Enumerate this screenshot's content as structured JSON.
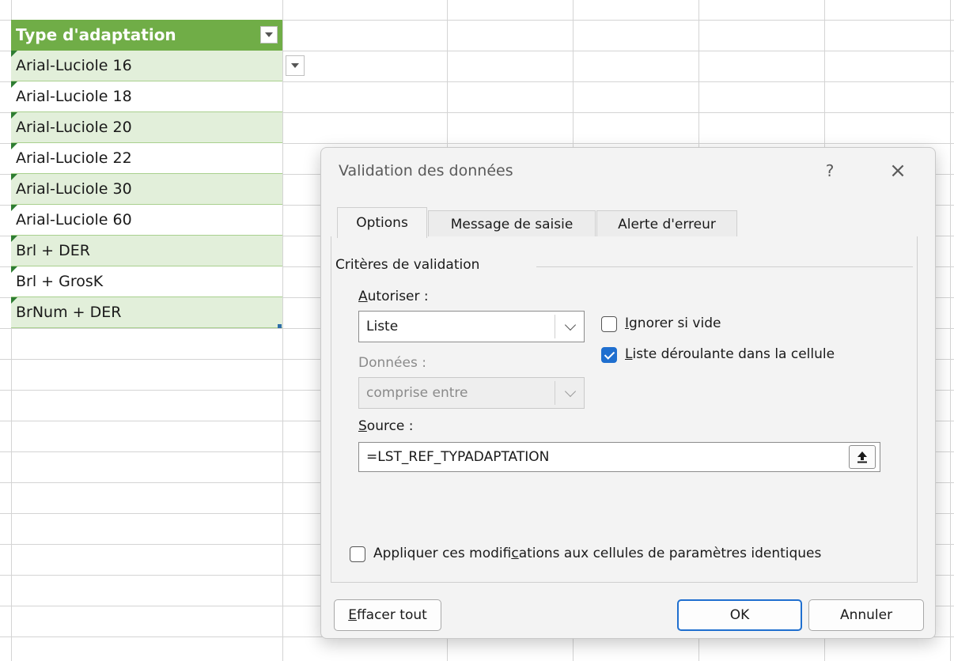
{
  "table": {
    "header": "Type d'adaptation",
    "rows": [
      "Arial-Luciole 16",
      "Arial-Luciole 18",
      "Arial-Luciole 20",
      "Arial-Luciole 22",
      "Arial-Luciole 30",
      "Arial-Luciole 60",
      "Brl + DER",
      "Brl + GrosK",
      "BrNum + DER"
    ]
  },
  "dialog": {
    "title": "Validation des données",
    "help": "?",
    "close": "×",
    "tabs": [
      "Options",
      "Message de saisie",
      "Alerte d'erreur"
    ],
    "active_tab": "Options",
    "group_title": "Critères de validation",
    "allow_label_key": "A",
    "allow_label_rest": "utoriser :",
    "allow_value": "Liste",
    "data_label": "Données :",
    "data_value": "comprise entre",
    "ignore_blank_key": "I",
    "ignore_blank_rest": "gnorer si vide",
    "ignore_blank_checked": false,
    "in_cell_dropdown_key": "L",
    "in_cell_dropdown_rest": "iste déroulante dans la cellule",
    "in_cell_dropdown_checked": true,
    "source_label_key": "S",
    "source_label_rest": "ource :",
    "source_value": "=LST_REF_TYPADAPTATION",
    "apply_pre": "Appliquer ces modifi",
    "apply_key": "c",
    "apply_post": "ations aux cellules de paramètres identiques",
    "apply_checked": false,
    "clear_key": "E",
    "clear_rest": "ffacer tout",
    "ok": "OK",
    "cancel": "Annuler"
  },
  "colors": {
    "table_header": "#70ad47",
    "table_band": "#e2efda",
    "accent": "#1f6fcf"
  }
}
